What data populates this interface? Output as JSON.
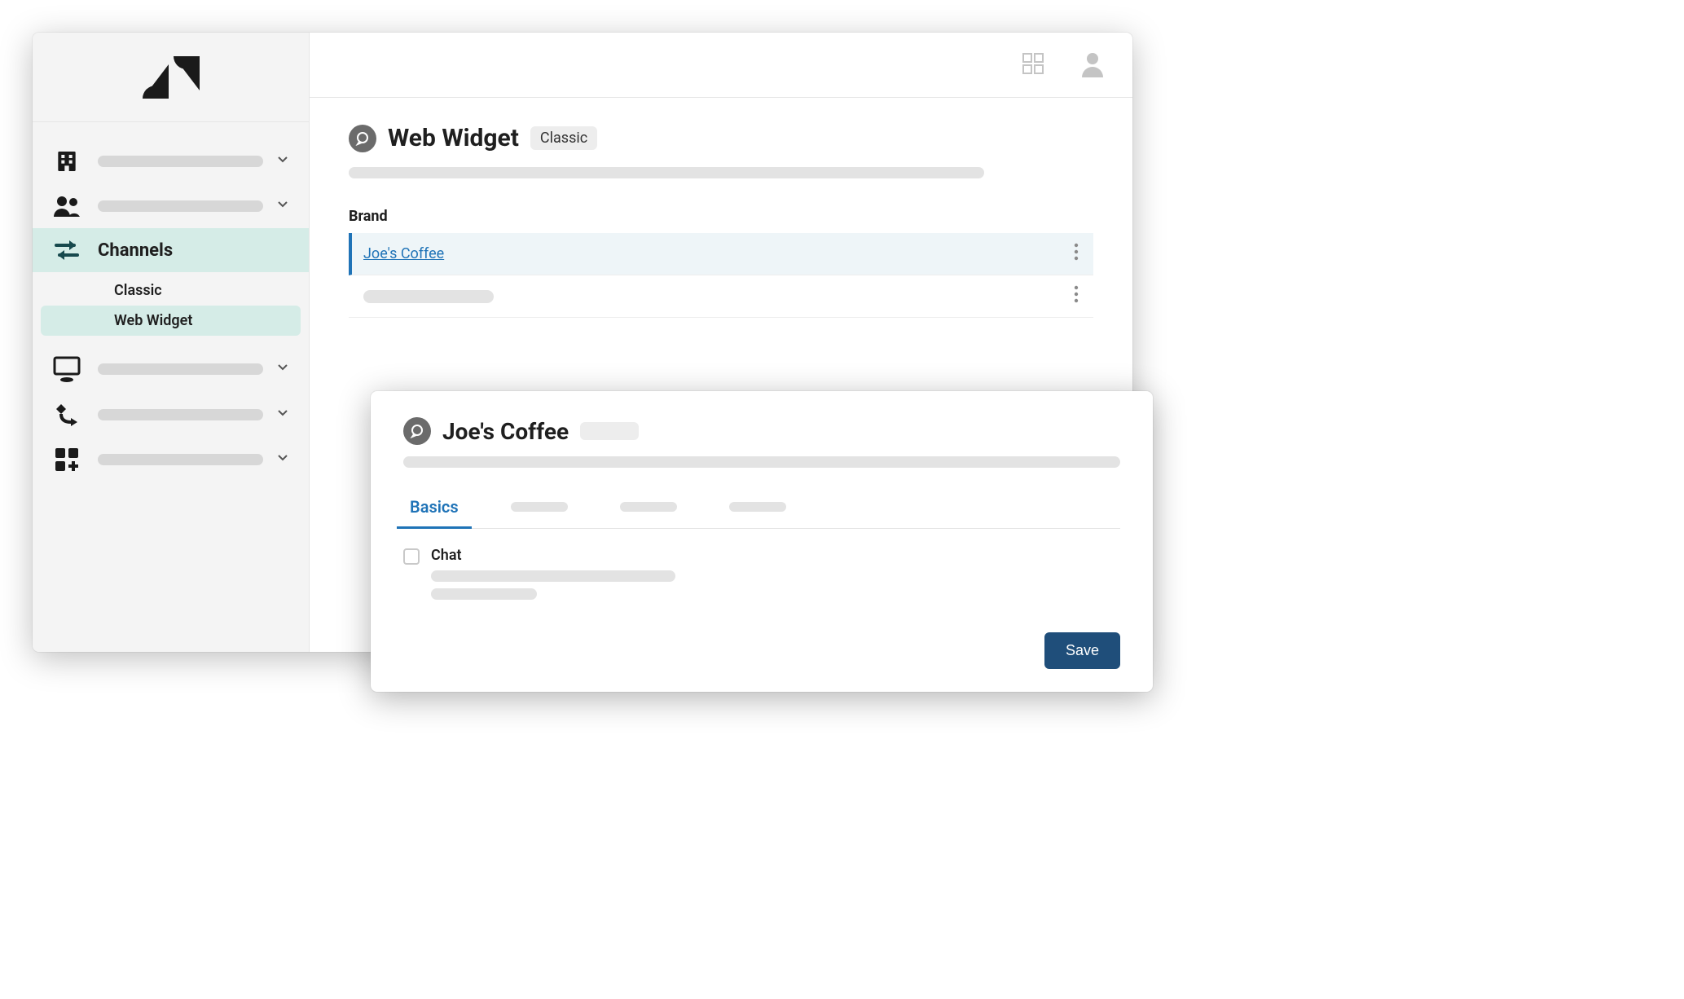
{
  "sidebar": {
    "channels_label": "Channels",
    "sub_classic": "Classic",
    "sub_web_widget": "Web Widget"
  },
  "page": {
    "title": "Web Widget",
    "badge": "Classic",
    "brand_label": "Brand",
    "selected_brand": "Joe's Coffee"
  },
  "overlay": {
    "title": "Joe's Coffee",
    "tab_basics": "Basics",
    "chat_label": "Chat",
    "save_label": "Save"
  }
}
